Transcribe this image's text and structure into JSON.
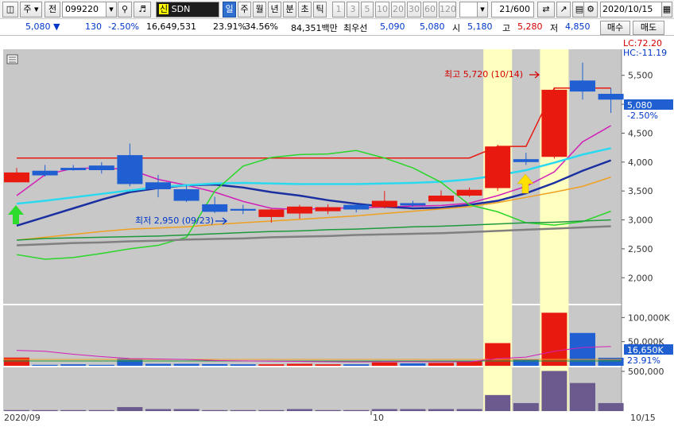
{
  "toolbar": {
    "market_label": "주",
    "prev_label": "전",
    "stock_code": "099220",
    "name_tag": "신",
    "stock_name": "SDN",
    "periods": [
      "일",
      "주",
      "월",
      "년",
      "분",
      "초",
      "틱"
    ],
    "minute_options": [
      "1",
      "3",
      "5",
      "10",
      "20",
      "30",
      "60",
      "120"
    ],
    "count": "21/600",
    "date": "2020/10/15"
  },
  "quote": {
    "price": "5,080",
    "change": "130",
    "change_pct": "-2.50%",
    "volume": "16,649,531",
    "turnover_pct": "23.91%",
    "ratio_pct": "34.56%",
    "value": "84,351백만",
    "best_label": "최우선",
    "ask": "5,090",
    "bid": "5,080",
    "open_label": "시",
    "open": "5,180",
    "high_label": "고",
    "high": "5,280",
    "low_label": "저",
    "low": "4,850",
    "buy_label": "매수",
    "sell_label": "매도"
  },
  "chart": {
    "lc_label": "LC:72.20",
    "hc_label": "HC:-11.19",
    "current_price": "5,080",
    "current_change": "-2.50%",
    "high_note": "최고 5,720 (10/14)",
    "low_note": "최저 2,950 (09/23)",
    "vol_current": "16,650K",
    "vol_pct": "23.91%",
    "x_start": "2020/09",
    "x_mid": "10",
    "x_end": "10/15",
    "colors": {
      "up": "#e8190f",
      "down": "#1f5fd1",
      "highlight": "#ffffc0"
    }
  },
  "chart_data": {
    "type": "candlestick",
    "price_axis": {
      "ticks": [
        2000,
        2500,
        3000,
        3500,
        4000,
        4500,
        5000,
        5500
      ],
      "ylim": [
        1550,
        5950
      ]
    },
    "volume_axis": {
      "ticks": [
        "100,000K",
        "50,000K"
      ],
      "ylim_k": [
        0,
        122000
      ]
    },
    "lower_axis": {
      "ticks": [
        "500,000"
      ]
    },
    "candles": [
      {
        "o": 3650,
        "h": 3900,
        "l": 3650,
        "c": 3820,
        "v": 17000
      },
      {
        "o": 3850,
        "h": 3950,
        "l": 3750,
        "c": 3770,
        "v": 2000
      },
      {
        "o": 3900,
        "h": 3950,
        "l": 3850,
        "c": 3860,
        "v": 3000
      },
      {
        "o": 3940,
        "h": 4000,
        "l": 3800,
        "c": 3860,
        "v": 2000
      },
      {
        "o": 4120,
        "h": 4320,
        "l": 3580,
        "c": 3620,
        "v": 15000
      },
      {
        "o": 3650,
        "h": 3780,
        "l": 3390,
        "c": 3530,
        "v": 4000
      },
      {
        "o": 3530,
        "h": 3600,
        "l": 3310,
        "c": 3330,
        "v": 4000
      },
      {
        "o": 3270,
        "h": 3400,
        "l": 3120,
        "c": 3140,
        "v": 3500
      },
      {
        "o": 3190,
        "h": 3260,
        "l": 3100,
        "c": 3160,
        "v": 3000
      },
      {
        "o": 3050,
        "h": 3190,
        "l": 2950,
        "c": 3180,
        "v": 3000
      },
      {
        "o": 3110,
        "h": 3260,
        "l": 3020,
        "c": 3230,
        "v": 4000
      },
      {
        "o": 3150,
        "h": 3270,
        "l": 3100,
        "c": 3220,
        "v": 3000
      },
      {
        "o": 3260,
        "h": 3280,
        "l": 3130,
        "c": 3180,
        "v": 3000
      },
      {
        "o": 3220,
        "h": 3500,
        "l": 3200,
        "c": 3330,
        "v": 7000
      },
      {
        "o": 3290,
        "h": 3330,
        "l": 3230,
        "c": 3250,
        "v": 5000
      },
      {
        "o": 3320,
        "h": 3510,
        "l": 3320,
        "c": 3420,
        "v": 6000
      },
      {
        "o": 3420,
        "h": 3560,
        "l": 3400,
        "c": 3520,
        "v": 9000
      },
      {
        "o": 3550,
        "h": 4300,
        "l": 3500,
        "c": 4270,
        "v": 47000
      },
      {
        "o": 4050,
        "h": 4160,
        "l": 3950,
        "c": 4000,
        "v": 13000
      },
      {
        "o": 4090,
        "h": 5280,
        "l": 4060,
        "c": 5250,
        "v": 110000
      },
      {
        "o": 5410,
        "h": 5720,
        "l": 5080,
        "c": 5220,
        "v": 68000
      },
      {
        "o": 5180,
        "h": 5280,
        "l": 4850,
        "c": 5080,
        "v": 16650
      }
    ],
    "series": [
      {
        "color": "#e8190f",
        "values": [
          4070,
          4070,
          4070,
          4070,
          4070,
          4070,
          4070,
          4070,
          4070,
          4070,
          4070,
          4070,
          4070,
          4070,
          4070,
          4070,
          4070,
          4270,
          4270,
          5280,
          5280,
          5280
        ]
      },
      {
        "color": "#d21fb8",
        "values": [
          3420,
          3780,
          3890,
          3900,
          3870,
          3700,
          3600,
          3480,
          3320,
          3200,
          3180,
          3200,
          3210,
          3220,
          3240,
          3250,
          3290,
          3420,
          3580,
          3830,
          4350,
          4630
        ]
      },
      {
        "color": "#1a2fa0",
        "values": [
          2900,
          3050,
          3200,
          3350,
          3480,
          3550,
          3600,
          3610,
          3560,
          3480,
          3420,
          3340,
          3280,
          3230,
          3200,
          3210,
          3260,
          3330,
          3460,
          3640,
          3850,
          4030
        ]
      },
      {
        "color": "#2ad9f0",
        "values": [
          3280,
          3330,
          3390,
          3450,
          3510,
          3570,
          3600,
          3630,
          3640,
          3630,
          3620,
          3620,
          3620,
          3630,
          3640,
          3660,
          3700,
          3770,
          3860,
          3990,
          4130,
          4240
        ]
      },
      {
        "color": "#f0a020",
        "values": [
          2650,
          2700,
          2750,
          2800,
          2840,
          2860,
          2880,
          2920,
          2950,
          2980,
          3010,
          3040,
          3070,
          3110,
          3150,
          3190,
          3230,
          3300,
          3390,
          3480,
          3580,
          3740
        ]
      },
      {
        "color": "#29d629",
        "values": [
          2400,
          2320,
          2350,
          2420,
          2500,
          2560,
          2700,
          3500,
          3930,
          4080,
          4130,
          4140,
          4200,
          4070,
          3900,
          3650,
          3260,
          3140,
          2950,
          2910,
          2970,
          3150
        ]
      },
      {
        "color": "#1e9a3c",
        "values": [
          2650,
          2680,
          2690,
          2700,
          2710,
          2720,
          2740,
          2760,
          2780,
          2800,
          2810,
          2830,
          2840,
          2860,
          2880,
          2890,
          2910,
          2930,
          2950,
          2960,
          2980,
          3000
        ]
      },
      {
        "color": "#808080",
        "values": [
          2560,
          2580,
          2600,
          2610,
          2630,
          2640,
          2660,
          2670,
          2680,
          2700,
          2710,
          2720,
          2740,
          2750,
          2760,
          2770,
          2790,
          2810,
          2830,
          2850,
          2870,
          2890
        ]
      }
    ],
    "volume_ma": [
      32000,
      30000,
      24000,
      19000,
      15000,
      14000,
      13000,
      11000,
      10000,
      9500,
      9000,
      8500,
      8000,
      8500,
      8500,
      8200,
      8300,
      15000,
      18000,
      30000,
      38000,
      40000
    ],
    "lower_bars": [
      1,
      1,
      1,
      1,
      4,
      2,
      2,
      1,
      1,
      1,
      2,
      1,
      1,
      2,
      2,
      2,
      2,
      16,
      8,
      40,
      28,
      8
    ],
    "highlights": [
      17,
      19
    ]
  }
}
